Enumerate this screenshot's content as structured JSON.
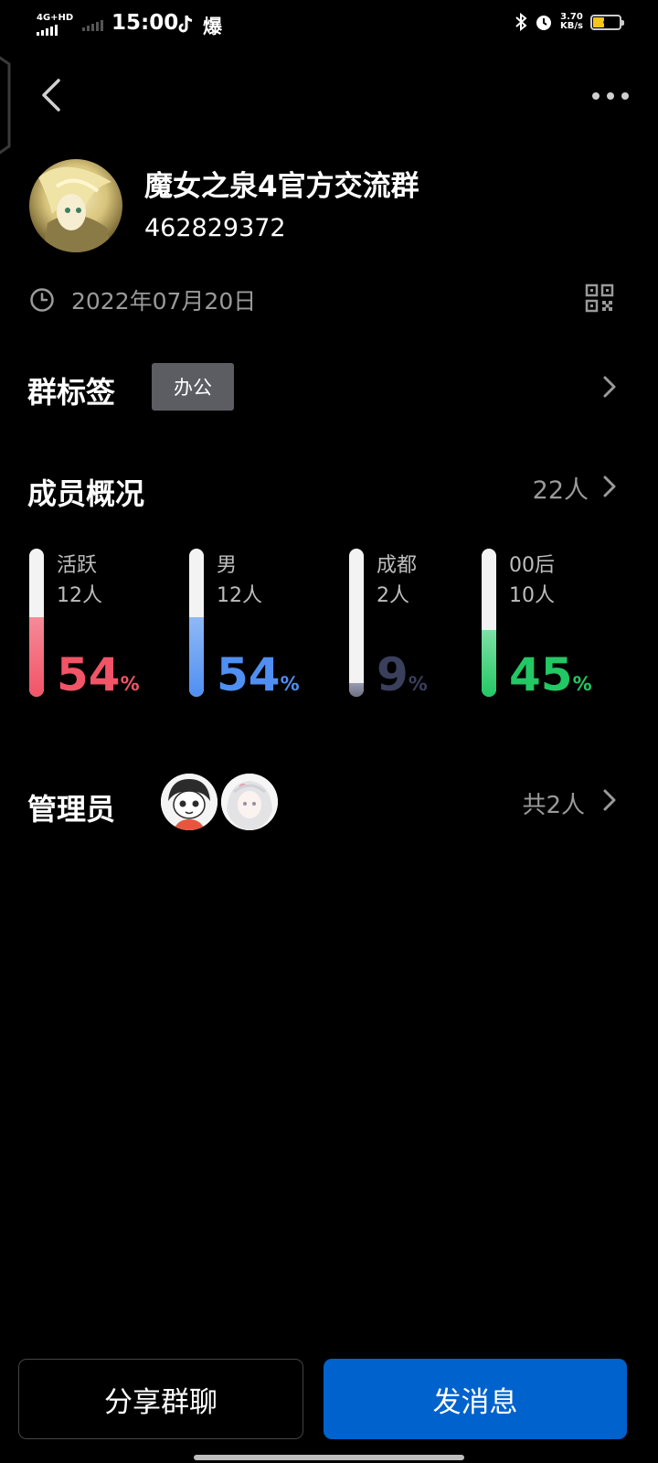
{
  "status_bar": {
    "network": "4G+HD",
    "time": "15:00",
    "app_glyph": "爆",
    "speed_value": "3.70",
    "speed_unit": "KB/s",
    "battery": "44",
    "battery_level": 0.44,
    "icons": [
      "signal-icon",
      "tiktok-icon",
      "bluetooth-icon",
      "alarm-icon",
      "battery-icon"
    ]
  },
  "header": {
    "back_icon": "chevron-left-icon",
    "more_icon": "more-horizontal-icon"
  },
  "group": {
    "name": "魔女之泉4官方交流群",
    "id": "462829372",
    "created_date": "2022年07月20日",
    "date_icon": "clock-icon",
    "qr_icon": "qr-code-icon"
  },
  "tags": {
    "title": "群标签",
    "items": [
      "办公"
    ]
  },
  "members": {
    "title": "成员概况",
    "count": "22人",
    "stats": [
      {
        "label": "活跃",
        "count": "12人",
        "percent": "54",
        "unit": "%",
        "level": 0.54,
        "color": "#f25467",
        "fill_top": "#f25467",
        "fill_bottom": "#f25467",
        "fill_light": "#f58a97"
      },
      {
        "label": "男",
        "count": "12人",
        "percent": "54",
        "unit": "%",
        "level": 0.54,
        "color": "#4f8ff2",
        "fill_top": "#4f8ff2",
        "fill_light": "#8fb9f7"
      },
      {
        "label": "成都",
        "count": "2人",
        "percent": "9",
        "unit": "%",
        "level": 0.09,
        "color": "#3a3f5c",
        "fill_top": "#6b6f85",
        "fill_light": "#9a9db0"
      },
      {
        "label": "00后",
        "count": "10人",
        "percent": "45",
        "unit": "%",
        "level": 0.45,
        "color": "#22c864",
        "fill_top": "#22c864",
        "fill_light": "#7fe0a5"
      }
    ]
  },
  "admins": {
    "title": "管理员",
    "total": "共2人"
  },
  "actions": {
    "share": "分享群聊",
    "send": "发消息"
  },
  "colors": {
    "background": "#000000",
    "primary_button": "#0062cc",
    "secondary_text": "#9a9a9a",
    "tag_chip": "#5b5d62"
  }
}
